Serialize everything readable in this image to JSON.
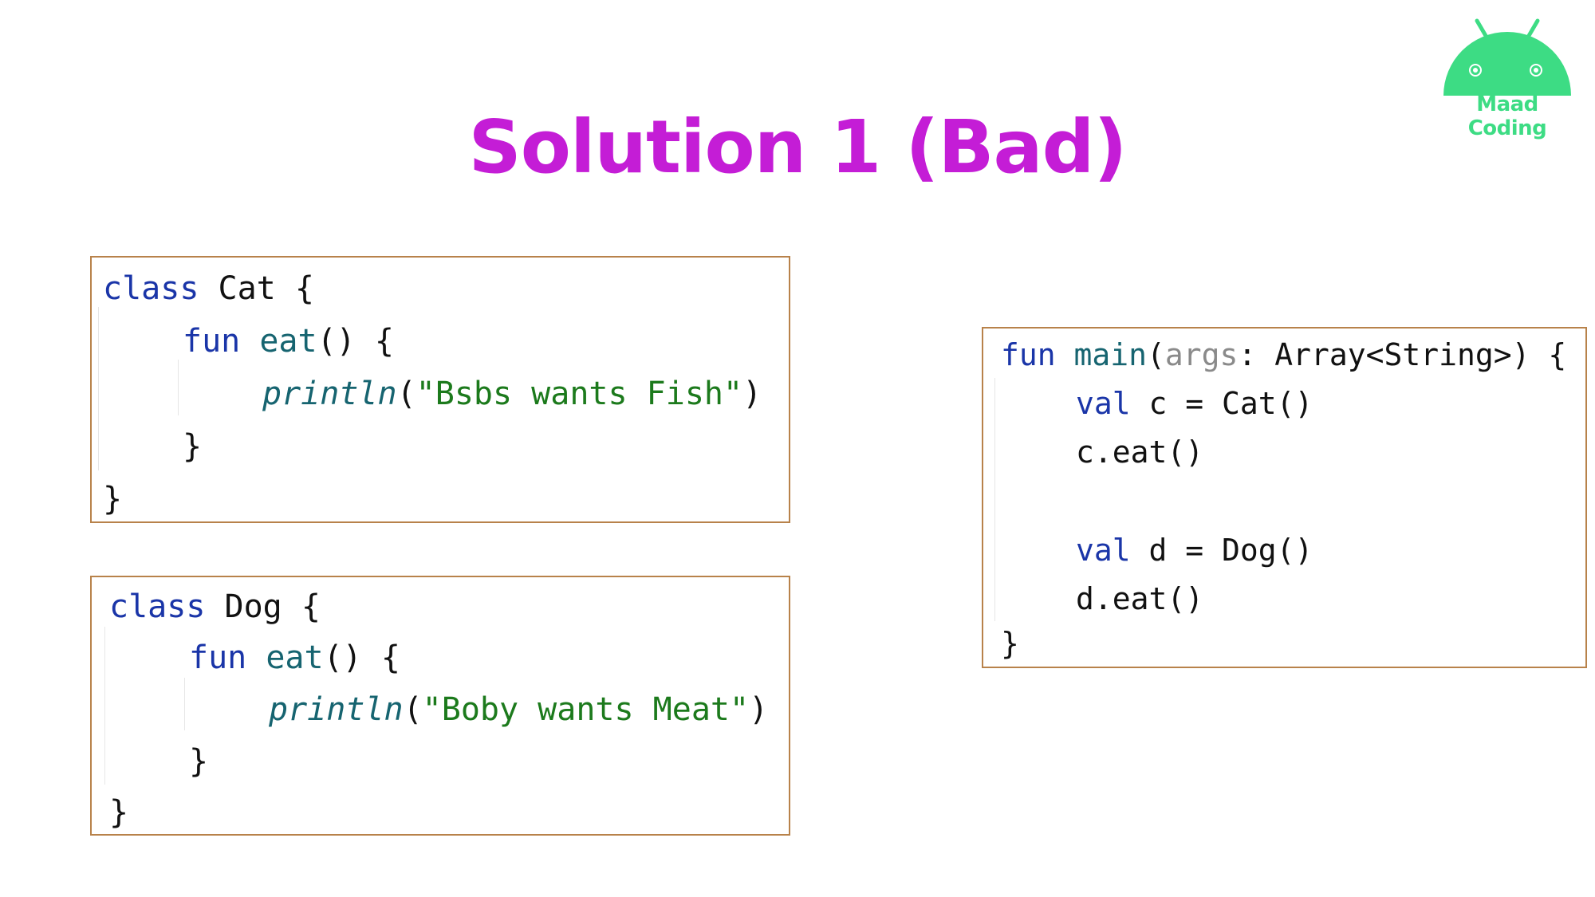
{
  "title": "Solution 1 (Bad)",
  "colors": {
    "title": "#c41dd6",
    "border": "#b8824a",
    "keyword": "#1a35a8",
    "string": "#1c7a1c",
    "logo": "#3ddc84"
  },
  "logo": {
    "icon": "android-icon",
    "text": "Maad Coding"
  },
  "cat_code": {
    "l1_kw": "class",
    "l1_rest": " Cat {",
    "l2_kw": "fun",
    "l2_fn": " eat",
    "l2_rest": "() {",
    "l3_call": "println",
    "l3_open": "(",
    "l3_str": "\"Bsbs wants Fish\"",
    "l3_close": ")",
    "l4": "}",
    "l5": "}"
  },
  "dog_code": {
    "l1_kw": "class",
    "l1_rest": " Dog {",
    "l2_kw": "fun",
    "l2_fn": " eat",
    "l2_rest": "() {",
    "l3_call": "println",
    "l3_open": "(",
    "l3_str": "\"Boby wants Meat\"",
    "l3_close": ")",
    "l4": "}",
    "l5": "}"
  },
  "main_code": {
    "l1_kw": "fun",
    "l1_fn": " main",
    "l1_open": "(",
    "l1_param": "args",
    "l1_rest": ": Array<String>) {",
    "l2_kw": "val",
    "l2_rest": " c = Cat()",
    "l3": "c.eat()",
    "l5_kw": "val",
    "l5_rest": " d = Dog()",
    "l6": "d.eat()",
    "l7": "}"
  }
}
